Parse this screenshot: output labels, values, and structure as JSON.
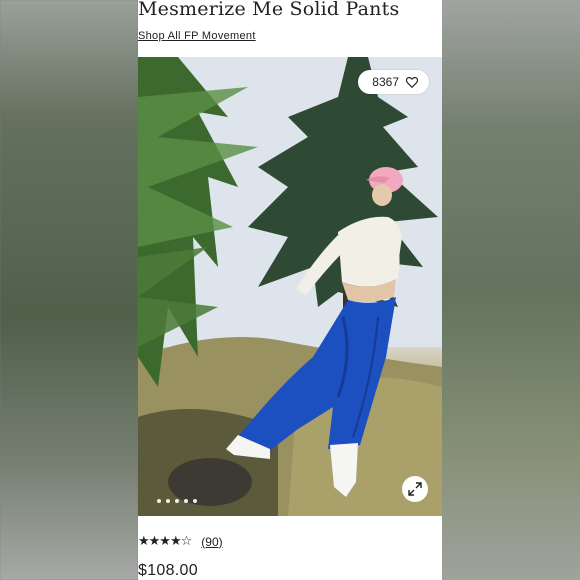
{
  "product": {
    "title": "Mesmerize Me Solid Pants",
    "shop_link": "Shop All FP Movement",
    "likes": "8367",
    "rating_stars": "★★★★☆",
    "rating_value": 4.5,
    "review_count": "(90)",
    "price": "$108.00"
  },
  "gallery": {
    "image_count": 5,
    "active_index": 0
  },
  "icons": {
    "like": "heart-icon",
    "expand": "expand-arrows-icon"
  },
  "colors": {
    "pants": "#1c4fc0",
    "cap": "#f2a8bf",
    "top": "#f1efe6"
  }
}
